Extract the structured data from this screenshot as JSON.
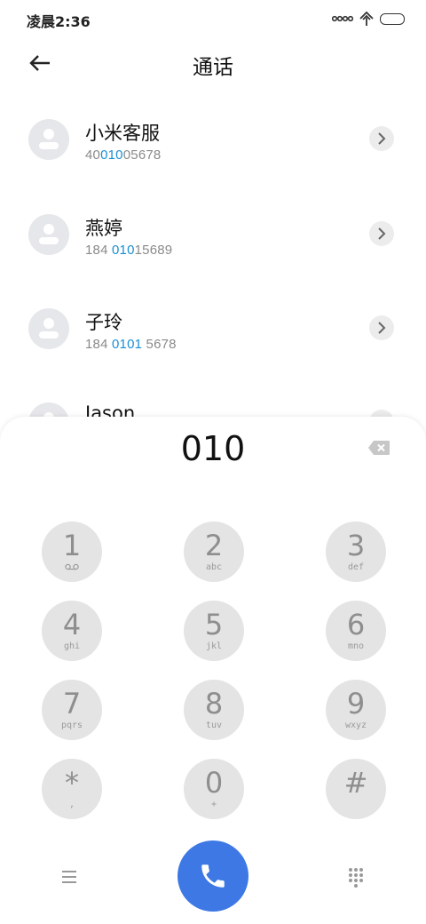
{
  "status_bar": {
    "time": "凌晨2:36",
    "icons": [
      "signal-icon",
      "wifi-icon",
      "battery-icon"
    ]
  },
  "header": {
    "title": "通话",
    "back_icon": "back-arrow-icon"
  },
  "contacts": [
    {
      "name": "小米客服",
      "number_pre": "40",
      "number_match": "010",
      "number_post": "05678"
    },
    {
      "name": "燕婷",
      "number_pre": "184 ",
      "number_match": "010",
      "number_post": "15689"
    },
    {
      "name": "子玲",
      "number_pre": "184 ",
      "number_match": "0101",
      "number_post": " 5678"
    },
    {
      "name": "Jason",
      "number_pre": "",
      "number_match": "",
      "number_post": ""
    }
  ],
  "dialer": {
    "input": "010",
    "keys": [
      {
        "digit": "1",
        "letters": "voicemail-icon"
      },
      {
        "digit": "2",
        "letters": "abc"
      },
      {
        "digit": "3",
        "letters": "def"
      },
      {
        "digit": "4",
        "letters": "ghi"
      },
      {
        "digit": "5",
        "letters": "jkl"
      },
      {
        "digit": "6",
        "letters": "mno"
      },
      {
        "digit": "7",
        "letters": "pqrs"
      },
      {
        "digit": "8",
        "letters": "tuv"
      },
      {
        "digit": "9",
        "letters": "wxyz"
      },
      {
        "digit": "*",
        "letters": ","
      },
      {
        "digit": "0",
        "letters": "+"
      },
      {
        "digit": "#",
        "letters": ""
      }
    ]
  },
  "colors": {
    "accent": "#3d78e5",
    "highlight": "#1a8fd6",
    "key_bg": "#e4e4e4"
  }
}
